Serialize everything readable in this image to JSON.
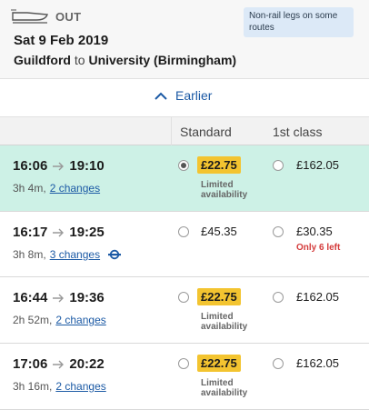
{
  "header": {
    "direction": "OUT",
    "date": "Sat 9 Feb 2019",
    "origin": "Guildford",
    "to_word": "to",
    "destination": "University (Birmingham)",
    "note": "Non-rail legs on some routes"
  },
  "earlier": {
    "label": "Earlier"
  },
  "columns": {
    "standard": "Standard",
    "first": "1st class"
  },
  "journeys": [
    {
      "depart": "16:06",
      "arrive": "19:10",
      "duration": "3h 4m,",
      "changes": "2 changes",
      "standard_price": "£22.75",
      "standard_note": "Limited availability",
      "first_price": "£162.05",
      "first_note": "",
      "selected": true
    },
    {
      "depart": "16:17",
      "arrive": "19:25",
      "duration": "3h 8m,",
      "changes": "3 changes",
      "standard_price": "£45.35",
      "standard_note": "",
      "first_price": "£30.35",
      "first_note": "Only 6 left",
      "selected": false
    },
    {
      "depart": "16:44",
      "arrive": "19:36",
      "duration": "2h 52m,",
      "changes": "2 changes",
      "standard_price": "£22.75",
      "standard_note": "Limited availability",
      "first_price": "£162.05",
      "first_note": "",
      "selected": false
    },
    {
      "depart": "17:06",
      "arrive": "20:22",
      "duration": "3h 16m,",
      "changes": "2 changes",
      "standard_price": "£22.75",
      "standard_note": "Limited availability",
      "first_price": "£162.05",
      "first_note": "",
      "selected": false
    }
  ],
  "colors": {
    "selected_row": "#cdf1e6",
    "badge": "#f3c430",
    "link": "#1c5aa5",
    "warning": "#d43b3b"
  }
}
